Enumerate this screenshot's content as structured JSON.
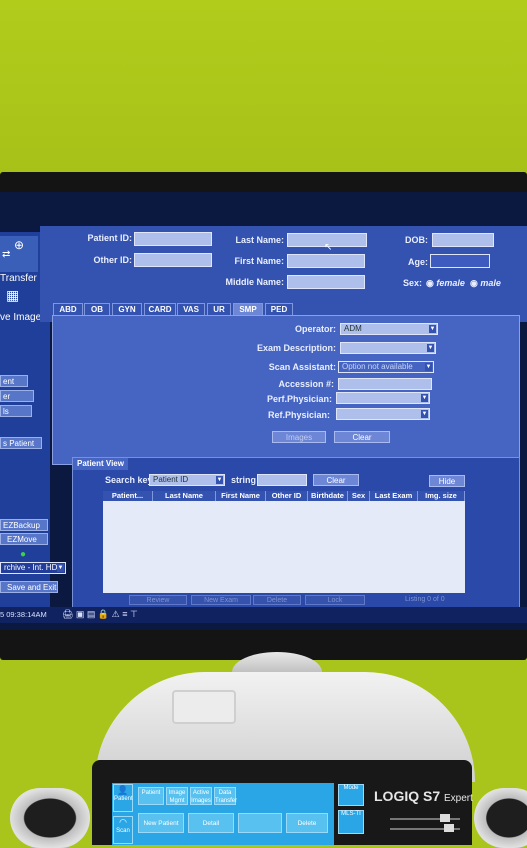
{
  "left_panel": {
    "transfer": "Transfer",
    "active_images": "ve Images",
    "buttons": [
      "ent",
      "er",
      "ls"
    ],
    "new_patient": "s Patient",
    "ezbackup": "EZBackup",
    "ezmove": "EZMove",
    "archive": "rchive - Int. HD",
    "save_exit": "Save and Exit"
  },
  "patient_form": {
    "patient_id": "Patient ID:",
    "last_name": "Last Name:",
    "dob": "DOB:",
    "other_id": "Other ID:",
    "first_name": "First Name:",
    "age": "Age:",
    "middle_name": "Middle Name:",
    "sex": "Sex:",
    "female": "female",
    "male": "male"
  },
  "tabs": [
    "ABD",
    "OB",
    "GYN",
    "CARD",
    "VAS",
    "UR",
    "SMP",
    "PED"
  ],
  "exam": {
    "operator_label": "Operator:",
    "operator_value": "ADM",
    "exam_description": "Exam Description:",
    "scan_assistant_label": "Scan Assistant:",
    "scan_assistant_value": "Option not available",
    "accession": "Accession #:",
    "perf_physician": "Perf.Physician:",
    "ref_physician": "Ref.Physician:",
    "images_button": "Images",
    "clear_button": "Clear"
  },
  "patient_view": {
    "title": "Patient View",
    "search_key_label": "Search key",
    "search_key_value": "Patient ID",
    "string_label": "string",
    "clear_button": "Clear",
    "hide_button": "Hide",
    "columns": [
      "Patient...",
      "Last Name",
      "First Name",
      "Other ID",
      "Birthdate",
      "Sex",
      "Last Exam",
      "Img. size"
    ],
    "bottom_buttons": [
      "Review",
      "New Exam",
      "Delete",
      "Lock"
    ],
    "listing": "Listing 0 of 0"
  },
  "status_bar": {
    "time": "5 09:38:14AM"
  },
  "console": {
    "brand": "LOGIQ S7",
    "brand_suffix": "Expert",
    "touch_tabs": [
      "Patient",
      "Image Mgmt",
      "Active Images",
      "Data Transfer"
    ],
    "touch_buttons": [
      "New Patient",
      "Detail",
      "",
      "Delete"
    ],
    "side_buttons": [
      "Patient",
      "Scan"
    ],
    "right_buttons": [
      "Mode",
      "MLS-TI"
    ]
  }
}
